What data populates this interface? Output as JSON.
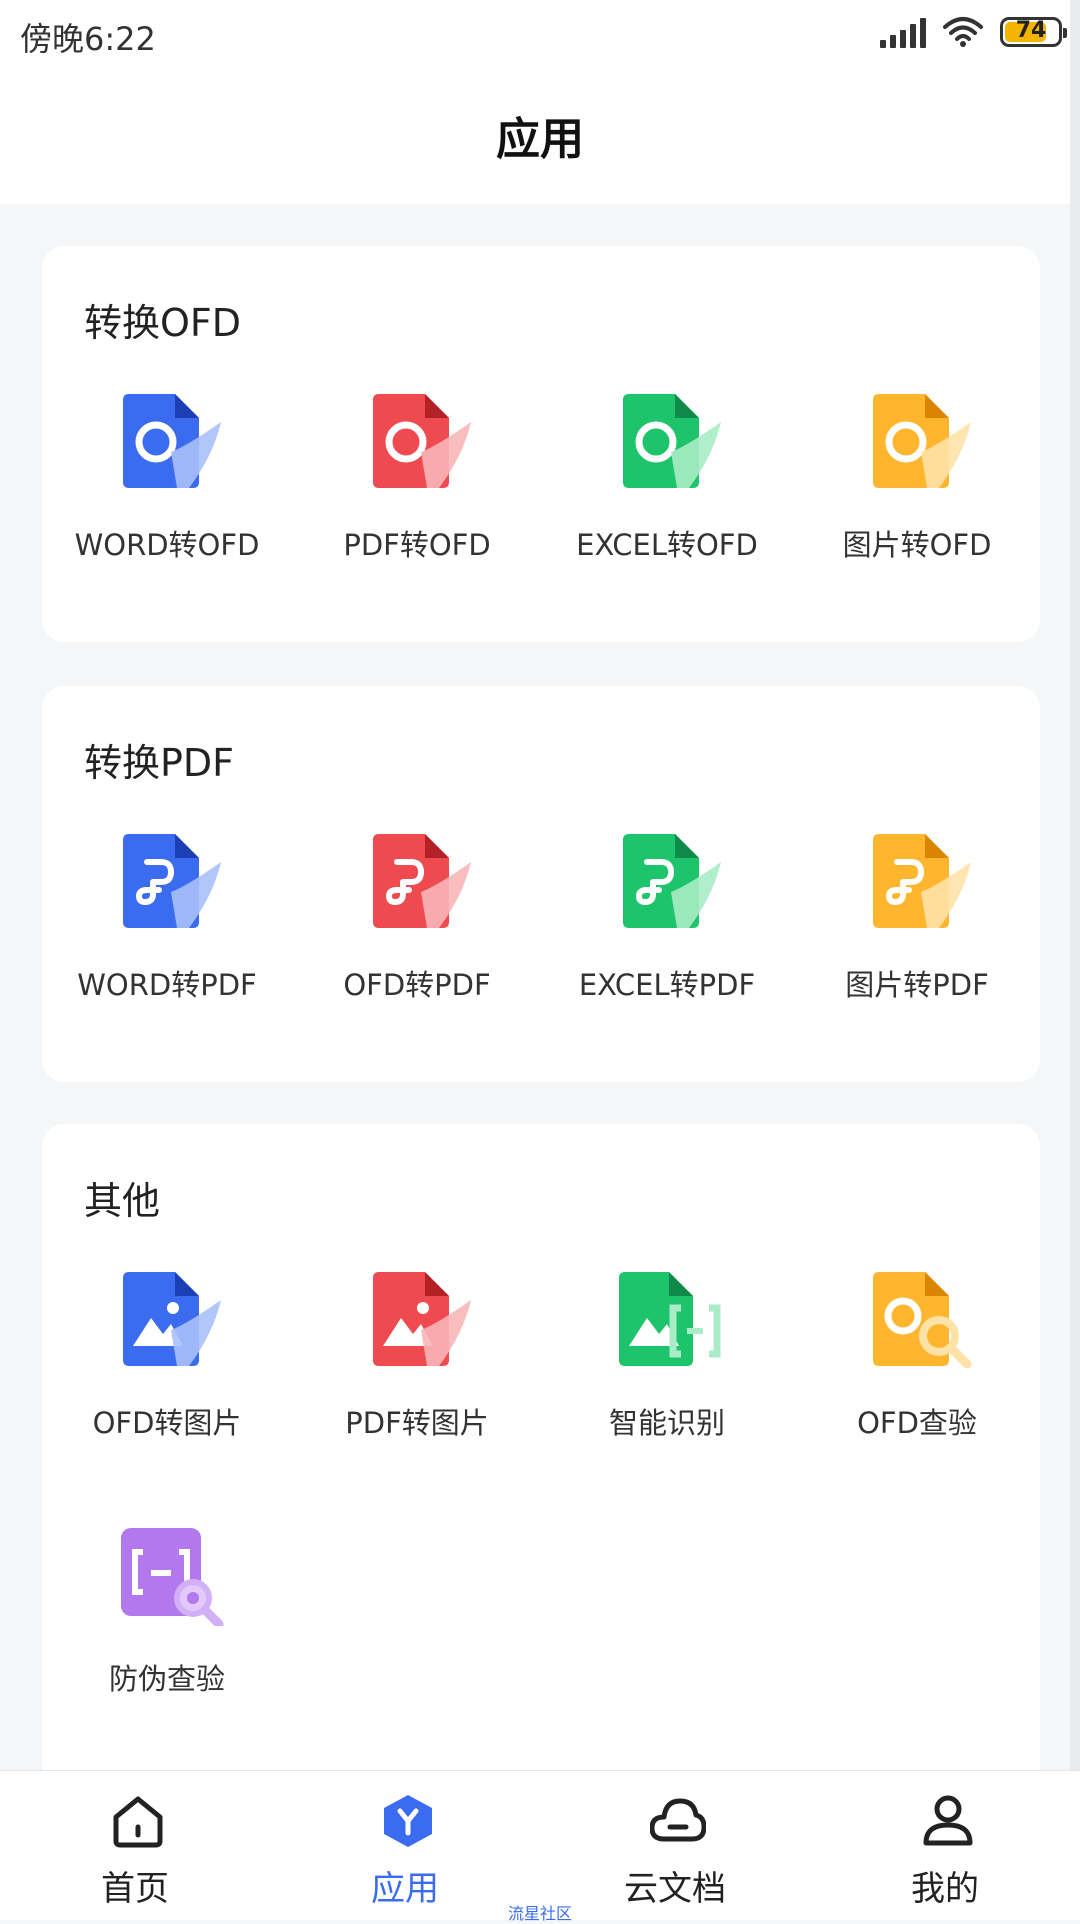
{
  "status_bar": {
    "time": "傍晚6:22",
    "battery": "74"
  },
  "header": {
    "title": "应用"
  },
  "colors": {
    "blue": "#3b6cf0",
    "red": "#ef4a4f",
    "green": "#1ec46b",
    "yellow": "#ffb62e",
    "purple": "#b278ee"
  },
  "sections": [
    {
      "title": "转换OFD",
      "items": [
        {
          "label": "WORD转OFD",
          "icon": "blue-ofd-convert-icon"
        },
        {
          "label": "PDF转OFD",
          "icon": "red-ofd-convert-icon"
        },
        {
          "label": "EXCEL转OFD",
          "icon": "green-ofd-convert-icon"
        },
        {
          "label": "图片转OFD",
          "icon": "yellow-ofd-convert-icon"
        }
      ]
    },
    {
      "title": "转换PDF",
      "items": [
        {
          "label": "WORD转PDF",
          "icon": "blue-pdf-convert-icon"
        },
        {
          "label": "OFD转PDF",
          "icon": "red-pdf-convert-icon"
        },
        {
          "label": "EXCEL转PDF",
          "icon": "green-pdf-convert-icon"
        },
        {
          "label": "图片转PDF",
          "icon": "yellow-pdf-convert-icon"
        }
      ]
    },
    {
      "title": "其他",
      "items": [
        {
          "label": "OFD转图片",
          "icon": "blue-image-convert-icon"
        },
        {
          "label": "PDF转图片",
          "icon": "red-image-convert-icon"
        },
        {
          "label": "智能识别",
          "icon": "smart-recognition-icon"
        },
        {
          "label": "OFD查验",
          "icon": "ofd-verify-icon"
        },
        {
          "label": "防伪查验",
          "icon": "anti-counterfeit-verify-icon"
        }
      ]
    }
  ],
  "tabbar": {
    "items": [
      {
        "label": "首页",
        "icon": "home-icon"
      },
      {
        "label": "应用",
        "icon": "apps-icon"
      },
      {
        "label": "云文档",
        "icon": "cloud-icon"
      },
      {
        "label": "我的",
        "icon": "profile-icon"
      }
    ]
  },
  "watermark": "流星社区"
}
